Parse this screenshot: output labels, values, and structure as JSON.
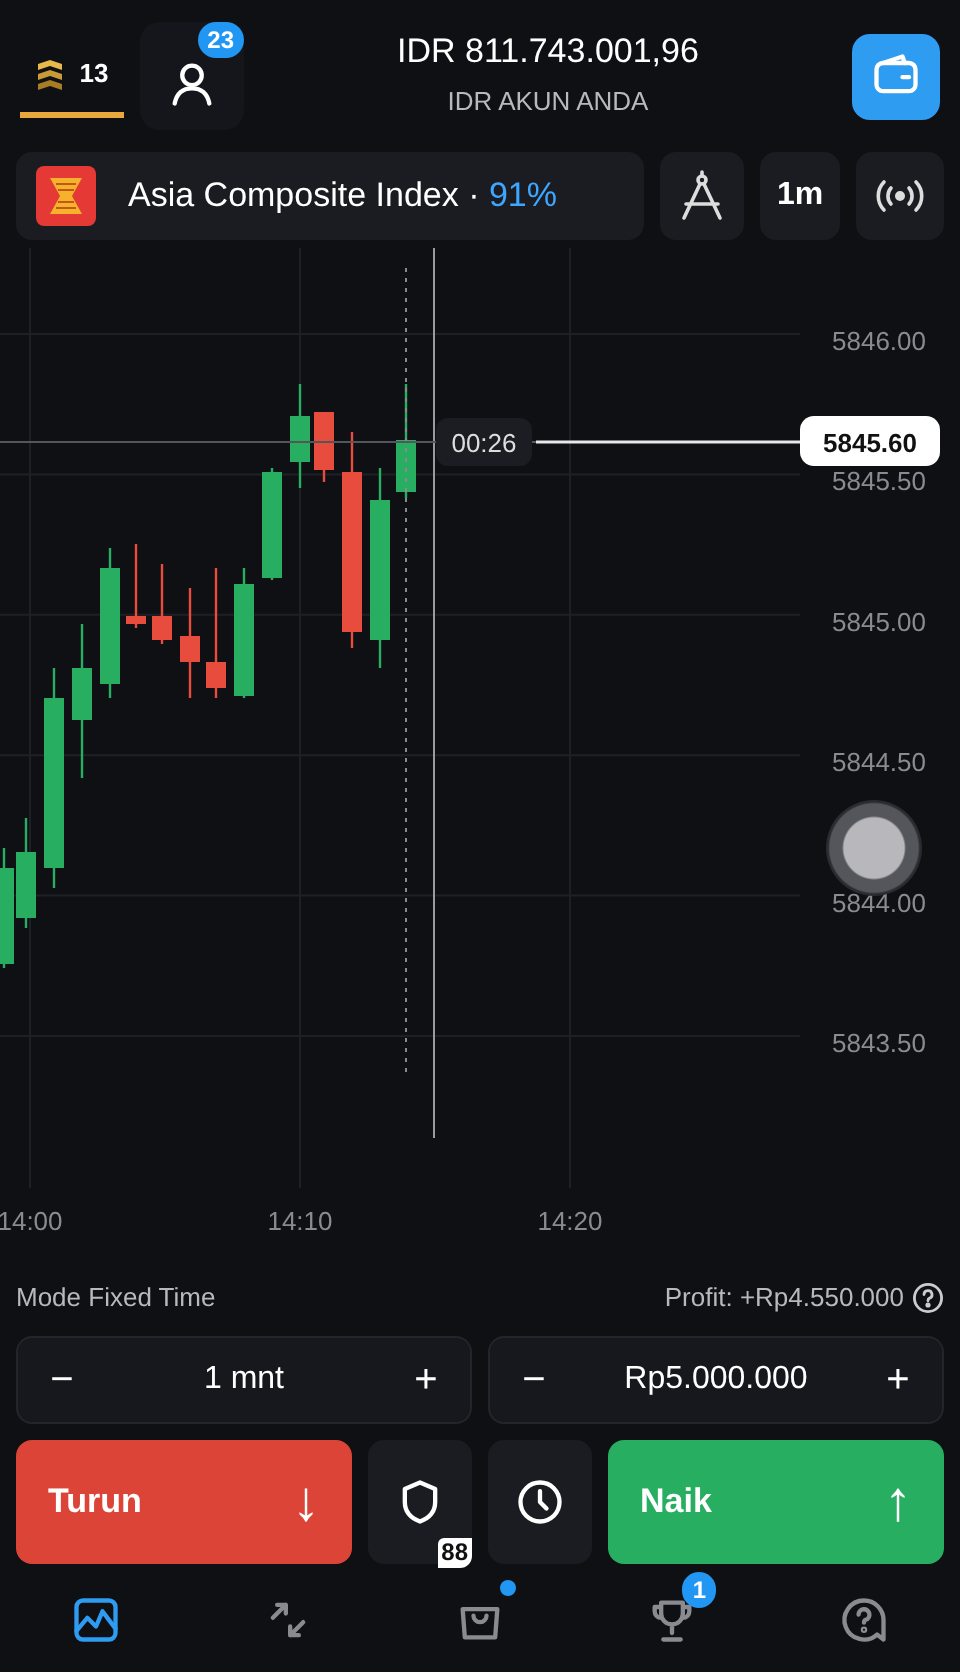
{
  "header": {
    "level_tab": {
      "label": "13",
      "selected": true
    },
    "profile_badge": "23",
    "balance": "IDR 811.743.001,96",
    "account": "IDR AKUN ANDA"
  },
  "asset": {
    "name": "Asia Composite Index",
    "separator": "·",
    "payout": "91%"
  },
  "toolbar": [
    {
      "kind": "drawing"
    },
    {
      "kind": "timeframe",
      "label": "1m"
    },
    {
      "kind": "signal"
    }
  ],
  "chart": {
    "y_labels": [
      "5846.00",
      "5845.50",
      "5845.00",
      "5844.50",
      "5844.00",
      "5843.50"
    ],
    "x_labels": [
      "14:00",
      "14:10",
      "14:20"
    ],
    "timer": "00:26",
    "price": "5845.60"
  },
  "trade": {
    "mode": "Mode Fixed Time",
    "profit": "Profit: +Rp4.550.000",
    "steppers": [
      {
        "minus": "−",
        "value": "1 mnt",
        "plus": "+"
      },
      {
        "minus": "−",
        "value": "Rp5.000.000",
        "plus": "+"
      }
    ]
  },
  "actions": [
    {
      "kind": "sell",
      "label": "Turun",
      "arrow": "↓"
    },
    {
      "kind": "shield",
      "badge": "88"
    },
    {
      "kind": "timer"
    },
    {
      "kind": "buy",
      "label": "Naik",
      "arrow": "↑"
    }
  ],
  "nav": [
    {
      "kind": "chart",
      "selected": true,
      "dot": false
    },
    {
      "kind": "swap",
      "selected": false,
      "dot": false
    },
    {
      "kind": "bag",
      "selected": false,
      "dot": true
    },
    {
      "kind": "trophy",
      "selected": false,
      "badge": "1"
    },
    {
      "kind": "help",
      "selected": false,
      "dot": false
    }
  ]
}
